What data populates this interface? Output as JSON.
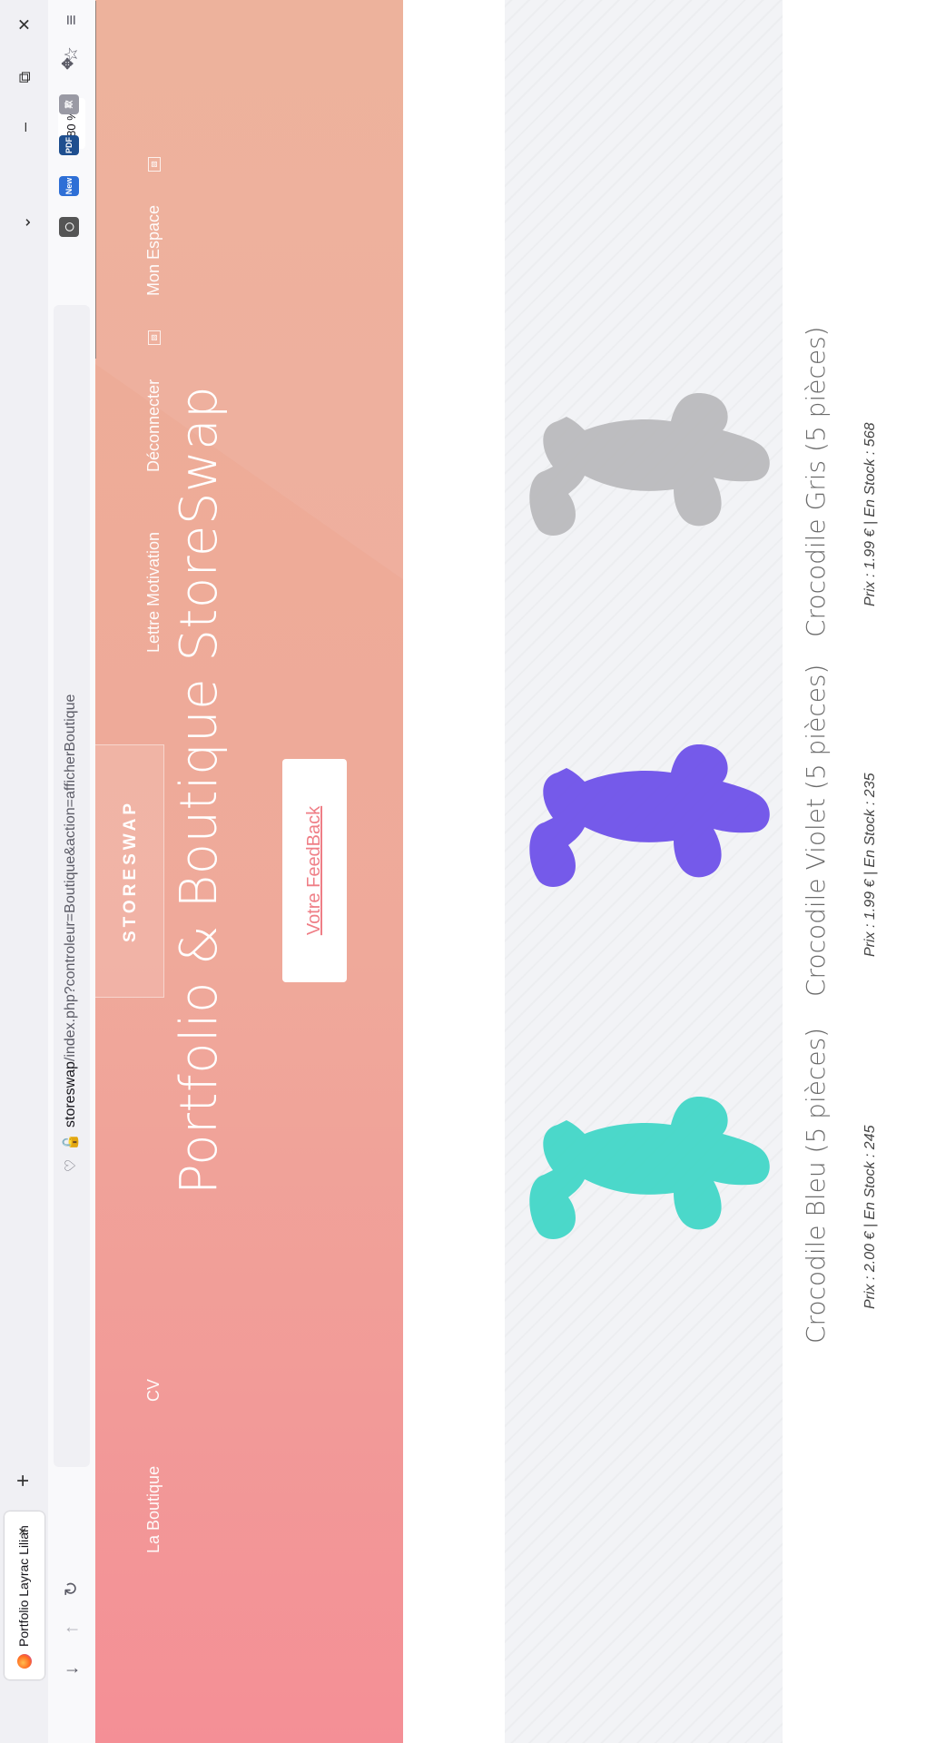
{
  "browser": {
    "tab_title": "Portfolio Layrac Lilian",
    "tab_close": "×",
    "new_tab": "+",
    "url_host": "storeswap",
    "url_path": "/index.php?controleur=Boutique&action=afficherBoutique",
    "zoom": "80 %",
    "ext_pdf": "PDF",
    "ext_new": "New"
  },
  "site": {
    "nav": {
      "boutique": "La Boutique",
      "cv": "CV",
      "brand": "STORESWAP",
      "lettre": "Lettre Motivation",
      "deconnecter": "Déconnecter",
      "espace": "Mon Espace"
    },
    "hero_title": "Portfolio & Boutique StoreSwap",
    "cta_label": "Votre FeedBack"
  },
  "products": [
    {
      "name": "Crocodile Bleu (5 pièces)",
      "prix_label": "Prix :",
      "prix": "2.00 €",
      "stock_label": "En Stock :",
      "stock": "245",
      "color": "#3dd6c5"
    },
    {
      "name": "Crocodile Violet (5 pièces)",
      "prix_label": "Prix :",
      "prix": "1.99 €",
      "stock_label": "En Stock :",
      "stock": "235",
      "color": "#6a4de8"
    },
    {
      "name": "Crocodile Gris (5 pièces)",
      "prix_label": "Prix :",
      "prix": "1.99 €",
      "stock_label": "En Stock :",
      "stock": "568",
      "color": "#b9b9bb"
    }
  ],
  "colors": {
    "hero_start": "#f48f96",
    "hero_end": "#ecae96",
    "accent": "#ef7e86"
  },
  "icons": {
    "window_close": "close-icon",
    "window_restore": "restore-icon",
    "window_minimize": "minimize-icon",
    "tab_list": "chevron-down-icon",
    "download": "download-icon",
    "back": "back-arrow-icon",
    "reload": "reload-icon",
    "menu": "hamburger-menu-icon"
  }
}
